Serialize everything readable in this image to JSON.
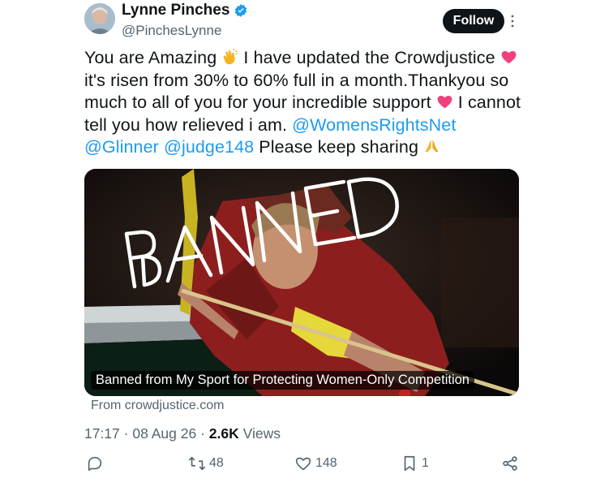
{
  "author": {
    "name": "Lynne Pinches",
    "handle": "@PinchesLynne",
    "avatar_icon": "avatar-photo",
    "verified_color": "#1d9bf0"
  },
  "follow_label": "Follow",
  "tweet": {
    "part1": "You are Amazing ",
    "part2": " I have updated the Crowdjustice ",
    "part3": " it's risen from 30% to 60% full in a month.Thankyou so much to all of you for your incredible support ",
    "part4": " I cannot tell you how relieved i am. ",
    "mention1": "@WomensRightsNet",
    "mention2": "@Glinner",
    "mention3": "@judge148",
    "part5": " Please keep sharing ",
    "emojis": [
      "clapping-hands",
      "red-heart",
      "red-heart",
      "folded-hands"
    ]
  },
  "card": {
    "overlay_text": "BANNED",
    "caption": "Banned from My Sport for Protecting Women-Only Competition",
    "source": "From crowdjustice.com"
  },
  "meta": {
    "time": "17:17",
    "date": "08 Aug 26",
    "views_count": "2.6K",
    "views_label": "Views"
  },
  "actions": {
    "replies": "",
    "retweets": "48",
    "likes": "148",
    "bookmarks": "1"
  },
  "colors": {
    "accent": "#1d9bf0",
    "text": "#0f1419",
    "muted": "#536471"
  }
}
